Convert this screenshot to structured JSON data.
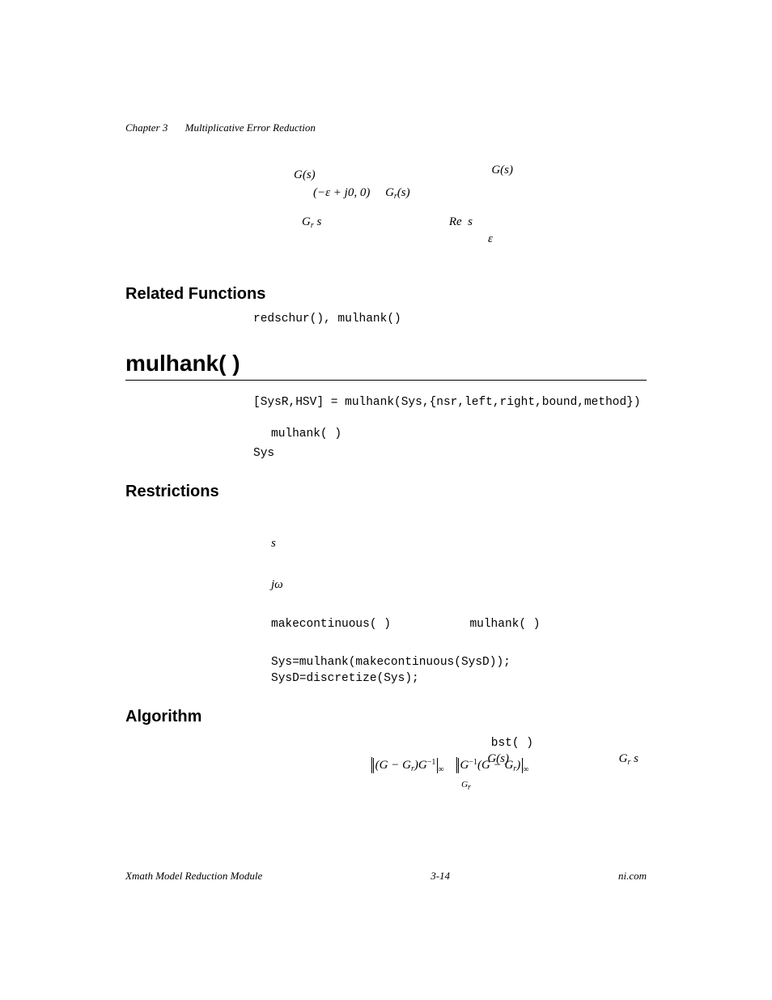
{
  "header": {
    "chapter_label": "Chapter 3",
    "chapter_title": "Multiplicative Error Reduction"
  },
  "intro_eq": {
    "right_term": "G(s)",
    "line1": "G(s)",
    "line2_a": "(−ε + j0, 0)",
    "line2_b": "G",
    "line2_b_sub": "r",
    "line2_b_tail": "(s)",
    "line3_left": "G",
    "line3_left_sub": "r",
    "line3_left_tail": "(s)",
    "line3_mid": "Re[s]",
    "line3_eps": "ε"
  },
  "related": {
    "heading": "Related Functions",
    "fns": "redschur(), mulhank()"
  },
  "title": "mulhank( )",
  "syntax": "[SysR,HSV] = mulhank(Sys,{nsr,left,right,bound,method})",
  "syntax_desc_a": "mulhank( )",
  "syntax_desc_b": "Sys",
  "restrictions": {
    "heading": "Restrictions",
    "bullet1_sym": "s",
    "bullet2_sym": "jω",
    "bullet3_a": "makecontinuous( )",
    "bullet3_b": "mulhank( )",
    "code1": "Sys=mulhank(makecontinuous(SysD));",
    "code2": "SysD=discretize(Sys);"
  },
  "algorithm": {
    "heading": "Algorithm",
    "ref_fn": "bst( )",
    "gs": "G(s)",
    "grs_label": "G",
    "grs_sub": "r",
    "grs_tail": "(s)",
    "under": "G",
    "under_sub": "r"
  },
  "footer": {
    "left": "Xmath Model Reduction Module",
    "center": "3-14",
    "right": "ni.com"
  }
}
